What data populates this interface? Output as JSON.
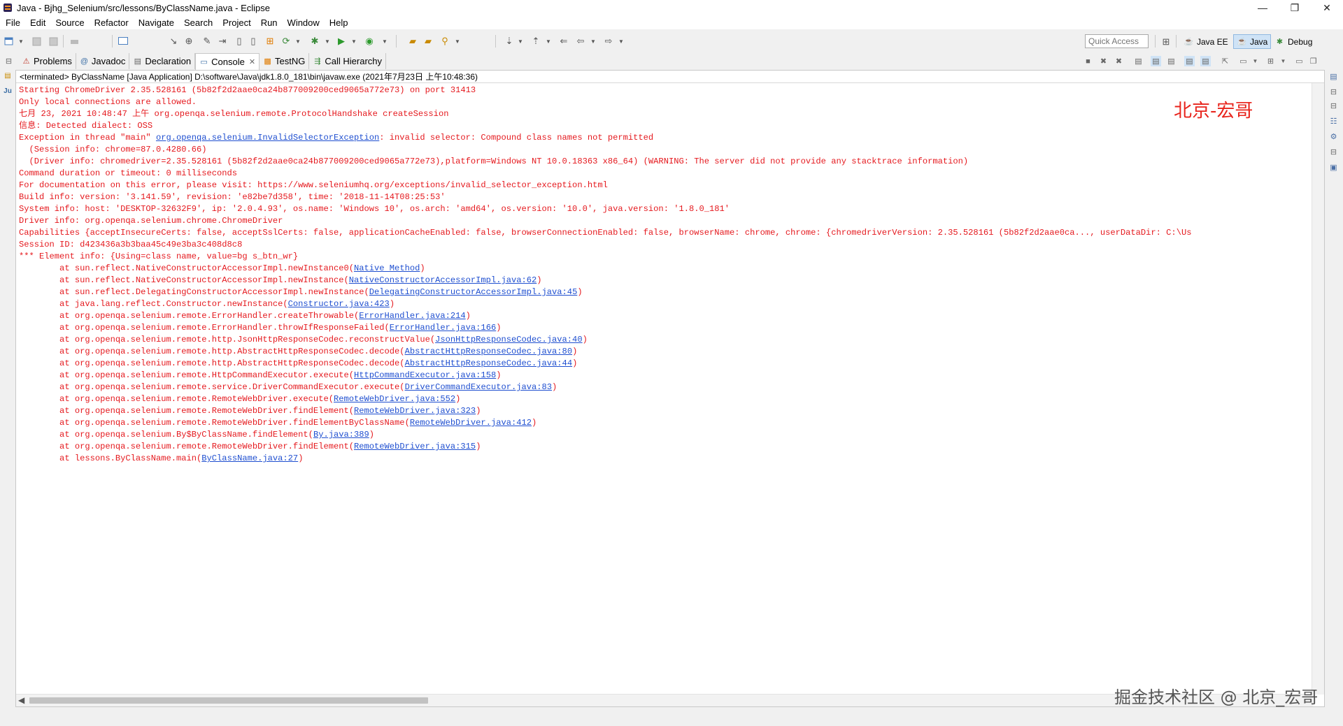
{
  "window": {
    "title": "Java - Bjhg_Selenium/src/lessons/ByClassName.java - Eclipse",
    "controls": {
      "minimize": "—",
      "maximize": "❐",
      "close": "✕"
    }
  },
  "menu": [
    "File",
    "Edit",
    "Source",
    "Refactor",
    "Navigate",
    "Search",
    "Project",
    "Run",
    "Window",
    "Help"
  ],
  "toolbar": {
    "quick_access_placeholder": "Quick Access",
    "perspectives": [
      {
        "label": "Java EE",
        "icon": "java-ee-icon",
        "active": false
      },
      {
        "label": "Java",
        "icon": "java-icon",
        "active": true
      },
      {
        "label": "Debug",
        "icon": "debug-icon",
        "active": false
      }
    ]
  },
  "tabs": [
    {
      "label": "Problems",
      "icon": "problems-icon",
      "active": false
    },
    {
      "label": "Javadoc",
      "icon": "javadoc-icon",
      "active": false
    },
    {
      "label": "Declaration",
      "icon": "declaration-icon",
      "active": false
    },
    {
      "label": "Console",
      "icon": "console-icon",
      "active": true,
      "close": "✕"
    },
    {
      "label": "TestNG",
      "icon": "testng-icon",
      "active": false
    },
    {
      "label": "Call Hierarchy",
      "icon": "call-hierarchy-icon",
      "active": false
    }
  ],
  "console": {
    "header": "<terminated> ByClassName [Java Application] D:\\software\\Java\\jdk1.8.0_181\\bin\\javaw.exe (2021年7月23日 上午10:48:36)",
    "lines": [
      {
        "text": "Starting ChromeDriver 2.35.528161 (5b82f2d2aae0ca24b877009200ced9065a772e73) on port 31413"
      },
      {
        "text": "Only local connections are allowed."
      },
      {
        "text": "七月 23, 2021 10:48:47 上午 org.openqa.selenium.remote.ProtocolHandshake createSession"
      },
      {
        "text": "信息: Detected dialect: OSS"
      },
      {
        "text": "Exception in thread \"main\" ",
        "link": "org.openqa.selenium.InvalidSelectorException",
        "after": ": invalid selector: Compound class names not permitted"
      },
      {
        "text": "  (Session info: chrome=87.0.4280.66)"
      },
      {
        "text": "  (Driver info: chromedriver=2.35.528161 (5b82f2d2aae0ca24b877009200ced9065a772e73),platform=Windows NT 10.0.18363 x86_64) (WARNING: The server did not provide any stacktrace information)"
      },
      {
        "text": "Command duration or timeout: 0 milliseconds"
      },
      {
        "text": "For documentation on this error, please visit: https://www.seleniumhq.org/exceptions/invalid_selector_exception.html"
      },
      {
        "text": "Build info: version: '3.141.59', revision: 'e82be7d358', time: '2018-11-14T08:25:53'"
      },
      {
        "text": "System info: host: 'DESKTOP-32632F9', ip: '2.0.4.93', os.name: 'Windows 10', os.arch: 'amd64', os.version: '10.0', java.version: '1.8.0_181'"
      },
      {
        "text": "Driver info: org.openqa.selenium.chrome.ChromeDriver"
      },
      {
        "text": "Capabilities {acceptInsecureCerts: false, acceptSslCerts: false, applicationCacheEnabled: false, browserConnectionEnabled: false, browserName: chrome, chrome: {chromedriverVersion: 2.35.528161 (5b82f2d2aae0ca..., userDataDir: C:\\Us"
      },
      {
        "text": "Session ID: d423436a3b3baa45c49e3ba3c408d8c8"
      },
      {
        "text": "*** Element info: {Using=class name, value=bg s_btn_wr}"
      },
      {
        "text": "\tat sun.reflect.NativeConstructorAccessorImpl.newInstance0(",
        "link": "Native Method",
        "after": ")"
      },
      {
        "text": "\tat sun.reflect.NativeConstructorAccessorImpl.newInstance(",
        "link": "NativeConstructorAccessorImpl.java:62",
        "after": ")"
      },
      {
        "text": "\tat sun.reflect.DelegatingConstructorAccessorImpl.newInstance(",
        "link": "DelegatingConstructorAccessorImpl.java:45",
        "after": ")"
      },
      {
        "text": "\tat java.lang.reflect.Constructor.newInstance(",
        "link": "Constructor.java:423",
        "after": ")"
      },
      {
        "text": "\tat org.openqa.selenium.remote.ErrorHandler.createThrowable(",
        "link": "ErrorHandler.java:214",
        "after": ")"
      },
      {
        "text": "\tat org.openqa.selenium.remote.ErrorHandler.throwIfResponseFailed(",
        "link": "ErrorHandler.java:166",
        "after": ")"
      },
      {
        "text": "\tat org.openqa.selenium.remote.http.JsonHttpResponseCodec.reconstructValue(",
        "link": "JsonHttpResponseCodec.java:40",
        "after": ")"
      },
      {
        "text": "\tat org.openqa.selenium.remote.http.AbstractHttpResponseCodec.decode(",
        "link": "AbstractHttpResponseCodec.java:80",
        "after": ")"
      },
      {
        "text": "\tat org.openqa.selenium.remote.http.AbstractHttpResponseCodec.decode(",
        "link": "AbstractHttpResponseCodec.java:44",
        "after": ")"
      },
      {
        "text": "\tat org.openqa.selenium.remote.HttpCommandExecutor.execute(",
        "link": "HttpCommandExecutor.java:158",
        "after": ")"
      },
      {
        "text": "\tat org.openqa.selenium.remote.service.DriverCommandExecutor.execute(",
        "link": "DriverCommandExecutor.java:83",
        "after": ")"
      },
      {
        "text": "\tat org.openqa.selenium.remote.RemoteWebDriver.execute(",
        "link": "RemoteWebDriver.java:552",
        "after": ")"
      },
      {
        "text": "\tat org.openqa.selenium.remote.RemoteWebDriver.findElement(",
        "link": "RemoteWebDriver.java:323",
        "after": ")"
      },
      {
        "text": "\tat org.openqa.selenium.remote.RemoteWebDriver.findElementByClassName(",
        "link": "RemoteWebDriver.java:412",
        "after": ")"
      },
      {
        "text": "\tat org.openqa.selenium.By$ByClassName.findElement(",
        "link": "By.java:389",
        "after": ")"
      },
      {
        "text": "\tat org.openqa.selenium.remote.RemoteWebDriver.findElement(",
        "link": "RemoteWebDriver.java:315",
        "after": ")"
      },
      {
        "text": "\tat lessons.ByClassName.main(",
        "link": "ByClassName.java:27",
        "after": ")"
      }
    ]
  },
  "watermarks": {
    "top": "北京-宏哥",
    "bottom": "掘金技术社区 @ 北京_宏哥"
  },
  "colors": {
    "error_text": "#e5191e",
    "link": "#1f4fd0",
    "active_perspective_bg": "#cfe3f6"
  }
}
